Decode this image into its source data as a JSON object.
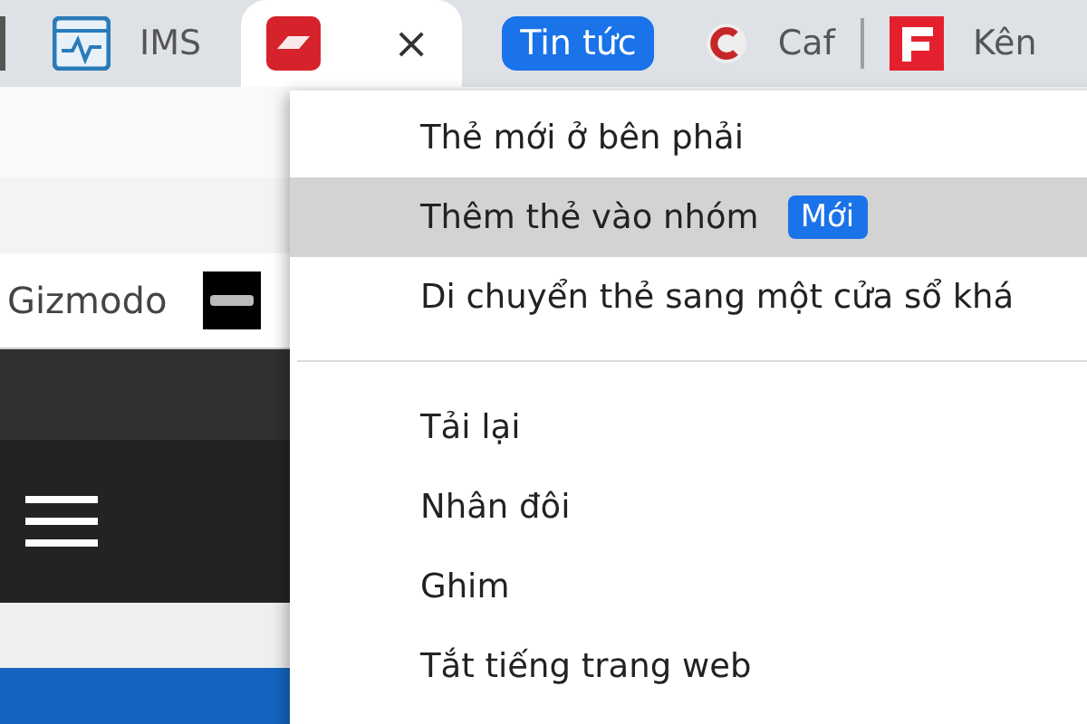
{
  "tabs": [
    {
      "kind": "tab",
      "title": "IMS",
      "selected": false
    },
    {
      "kind": "tab",
      "selected": true,
      "close": "×"
    },
    {
      "kind": "group",
      "title": "Tin tức",
      "color": "#1a73e8"
    },
    {
      "kind": "tab",
      "title": "Caf",
      "selected": false
    },
    {
      "kind": "tab",
      "title": "Kên",
      "selected": false
    }
  ],
  "bookmarks": [
    {
      "title": "Gizmodo"
    }
  ],
  "context_menu": {
    "items": [
      {
        "kind": "item",
        "label": "Thẻ mới ở bên phải",
        "highlighted": false
      },
      {
        "kind": "item",
        "label": "Thêm thẻ vào nhóm",
        "badge": "Mới",
        "highlighted": true
      },
      {
        "kind": "item",
        "label": "Di chuyển thẻ sang một cửa sổ khá",
        "highlighted": false
      },
      {
        "kind": "separator"
      },
      {
        "kind": "item",
        "label": "Tải lại",
        "highlighted": false
      },
      {
        "kind": "item",
        "label": "Nhân đôi",
        "highlighted": false
      },
      {
        "kind": "item",
        "label": "Ghim",
        "highlighted": false
      },
      {
        "kind": "item",
        "label": "Tắt tiếng trang web",
        "highlighted": false
      }
    ]
  }
}
